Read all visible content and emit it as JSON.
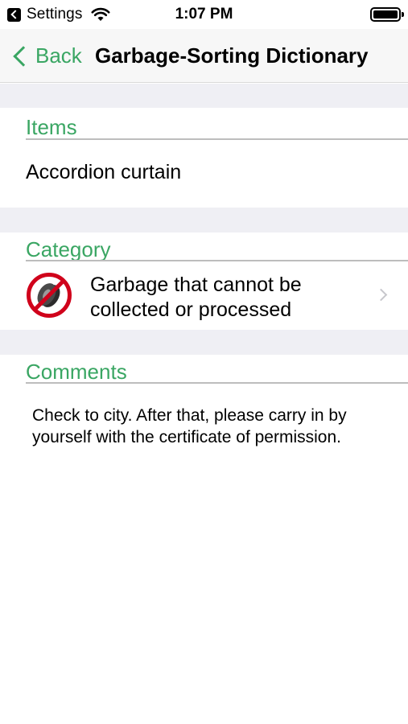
{
  "status_bar": {
    "app_label": "Settings",
    "time": "1:07 PM"
  },
  "nav": {
    "back_label": "Back",
    "title": "Garbage-Sorting Dictionary"
  },
  "items": {
    "header": "Items",
    "value": "Accordion curtain"
  },
  "category": {
    "header": "Category",
    "value": "Garbage that cannot be collected or processed",
    "icon": "no-tire-icon"
  },
  "comments": {
    "header": "Comments",
    "text": "Check to city. After that, please carry in by yourself with the certificate of permission."
  },
  "colors": {
    "accent": "#3aa663",
    "prohibited": "#d0021b"
  }
}
